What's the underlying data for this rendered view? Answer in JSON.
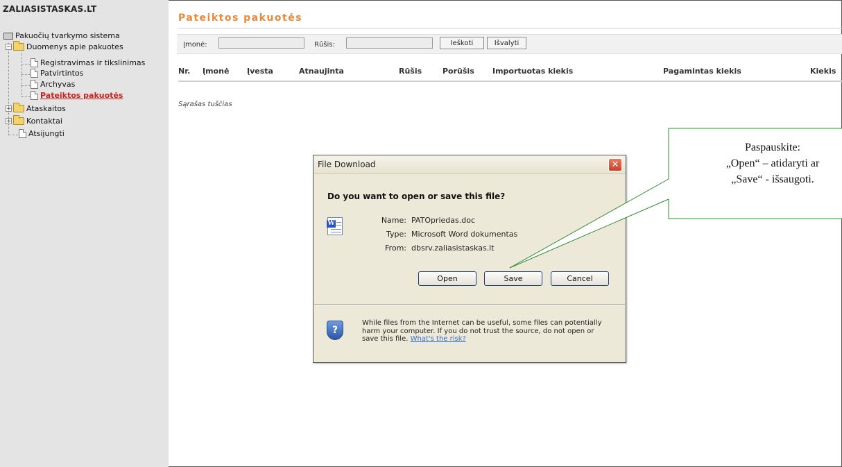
{
  "sidebar": {
    "site_title": "ZALIASISTASKAS.LT",
    "tree": {
      "root": "Pakuočių tvarkymo sistema",
      "data_folder": "Duomenys apie pakuotes",
      "items": [
        "Registravimas ir tikslinimas",
        "Patvirtintos",
        "Archyvas",
        "Pateiktos pakuotės"
      ],
      "active_item": "Pateiktos pakuotės",
      "reports_folder": "Ataskaitos",
      "contacts_folder": "Kontaktai",
      "logout": "Atsijungti"
    }
  },
  "main": {
    "title": "Pateiktos pakuotės",
    "search": {
      "company_label": "Įmonė:",
      "company_value": "",
      "type_label": "Rūšis:",
      "type_value": "",
      "search_button": "Ieškoti",
      "clear_button": "Išvalyti"
    },
    "table": {
      "columns": [
        "Nr.",
        "Įmonė",
        "Įvesta",
        "Atnaujinta",
        "Rūšis",
        "Porūšis",
        "Importuotas kiekis",
        "Pagamintas kiekis",
        "Kiekis"
      ],
      "rows": []
    },
    "empty_text": "Sąrašas tuščias"
  },
  "dialog": {
    "title": "File Download",
    "question": "Do you want to open or save this file?",
    "file_icon": "word-document-icon",
    "name_label": "Name:",
    "name_value": "PATOpriedas.doc",
    "type_label": "Type:",
    "type_value": "Microsoft Word dokumentas",
    "from_label": "From:",
    "from_value": "dbsrv.zaliasistaskas.lt",
    "open_button": "Open",
    "save_button": "Save",
    "cancel_button": "Cancel",
    "warning_text": "While files from the Internet can be useful, some files can potentially harm your computer. If you do not trust the source, do not open or save this file.",
    "risk_link": "What's the risk?"
  },
  "callout": {
    "line1": "Paspauskite:",
    "line2": "„Open“ – atidaryti ar",
    "line3": "„Save“ - išsaugoti."
  },
  "colors": {
    "title_accent": "#e8893b",
    "active_link": "#cc1f1f",
    "callout_border": "#2e8b2e",
    "sidebar_bg": "#e4e4e4"
  }
}
